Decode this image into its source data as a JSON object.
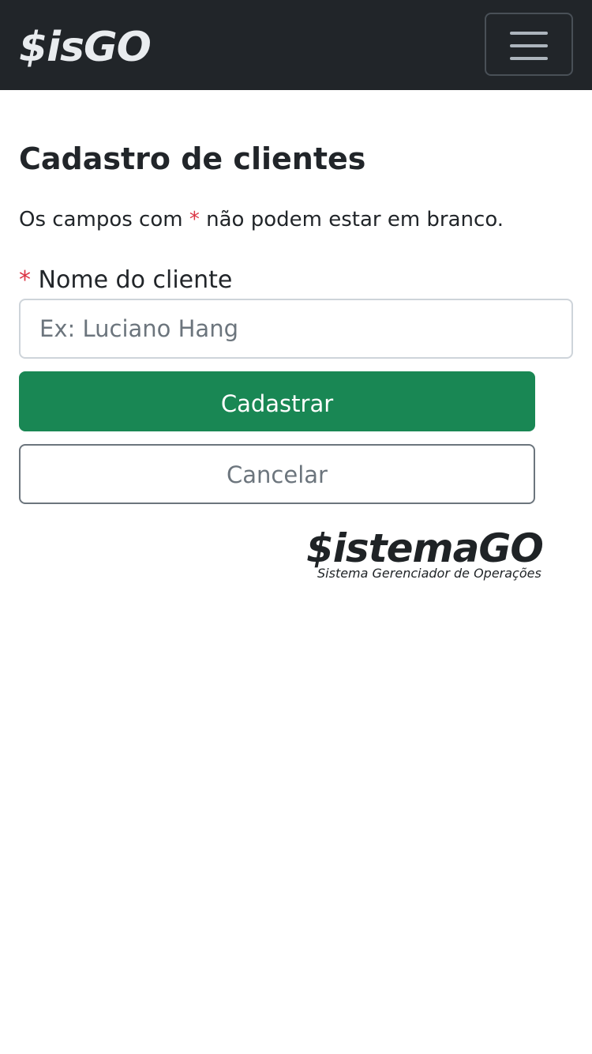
{
  "navbar": {
    "brand": "$isGO",
    "toggler_label": "Toggle navigation"
  },
  "page": {
    "title": "Cadastro de clientes",
    "note_prefix": "Os campos com",
    "note_required_mark": "*",
    "note_suffix": "não podem estar em branco."
  },
  "form": {
    "name_field": {
      "required_mark": "*",
      "label": "Nome do cliente",
      "value": "",
      "placeholder": "Ex: Luciano Hang"
    },
    "submit_label": "Cadastrar",
    "cancel_label": "Cancelar"
  },
  "footer_logo": {
    "main": "$istemaGO",
    "sub": "Sistema Gerenciador de Operações"
  },
  "colors": {
    "navbar_bg": "#212529",
    "primary_button": "#198754",
    "required_mark": "#dc3545",
    "secondary_button": "#6c757d"
  }
}
